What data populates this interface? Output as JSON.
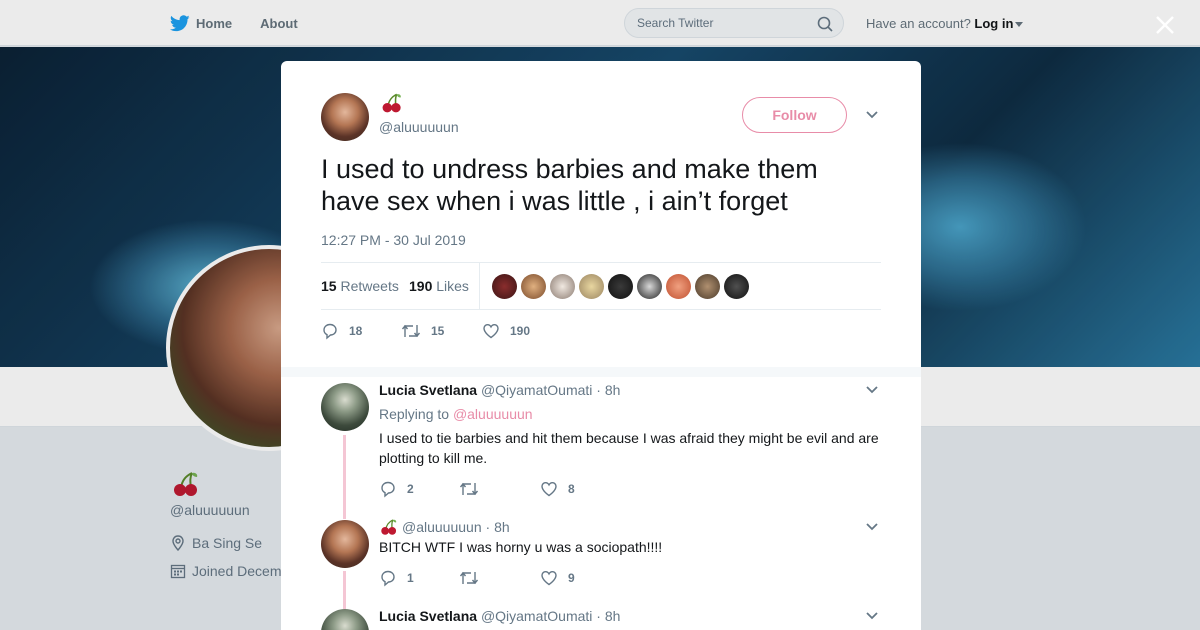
{
  "nav": {
    "home_label": "Home",
    "about_label": "About",
    "search_placeholder": "Search Twitter",
    "account_prompt": "Have an account?",
    "login_label": "Log in"
  },
  "background_profile": {
    "handle": "@aluuuuuun",
    "location": "Ba Sing Se",
    "joined": "Joined Decem"
  },
  "tweet": {
    "display_name_emoji": "cherry-emoji",
    "handle": "@aluuuuuun",
    "follow_label": "Follow",
    "text": "I used to undress barbies and make them have sex when i was little , i ain’t forget",
    "timestamp": "12:27 PM - 30 Jul 2019",
    "retweets_count": "15",
    "retweets_label": "Retweets",
    "likes_count": "190",
    "likes_label": "Likes",
    "actions": {
      "replies": "18",
      "retweets": "15",
      "likes": "190"
    }
  },
  "replies": [
    {
      "name": "Lucia Svetlana",
      "handle": "@QiyamatOumati",
      "time": "· 8h",
      "replying_prefix": "Replying to",
      "replying_to": "@aluuuuuun",
      "text": "I used to tie barbies and hit them because I was afraid they might be evil and are plotting to kill me.",
      "replies": "2",
      "retweets": "",
      "likes": "8"
    },
    {
      "name": "",
      "handle": "@aluuuuuun",
      "time": "· 8h",
      "text": "BITCH WTF I was horny u was a sociopath!!!!",
      "replies": "1",
      "retweets": "",
      "likes": "9"
    },
    {
      "name": "Lucia Svetlana",
      "handle": "@QiyamatOumati",
      "time": "· 8h"
    }
  ],
  "colors": {
    "accent_pink": "#e88ca8",
    "twitter_blue": "#1da1f2",
    "text_secondary": "#657786"
  }
}
